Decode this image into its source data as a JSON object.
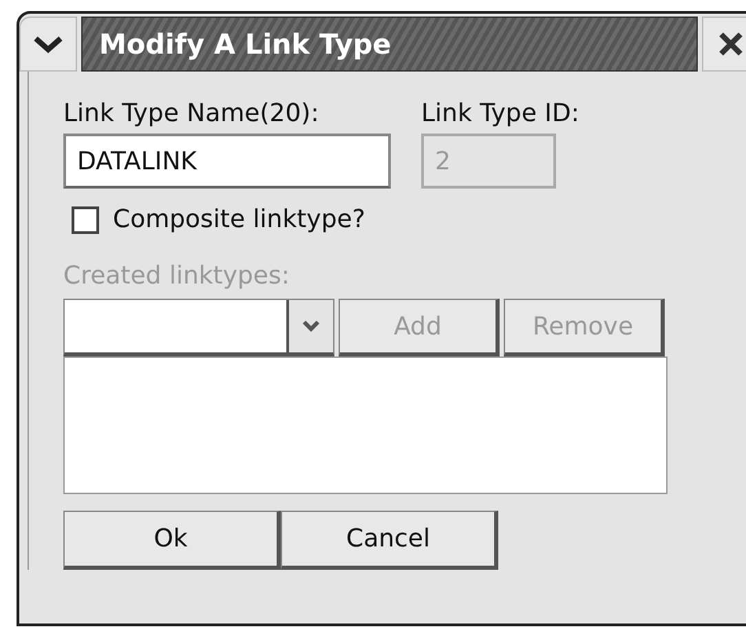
{
  "window": {
    "title": "Modify A Link Type"
  },
  "name_field": {
    "label": "Link Type Name(20):",
    "value": "DATALINK",
    "disabled": false
  },
  "id_field": {
    "label": "Link Type ID:",
    "value": "2",
    "disabled": true
  },
  "composite": {
    "label": "Composite linktype?",
    "checked": false
  },
  "created": {
    "label": "Created linktypes:",
    "disabled": true,
    "add": "Add",
    "remove": "Remove"
  },
  "buttons": [
    "Ok",
    "Cancel"
  ]
}
